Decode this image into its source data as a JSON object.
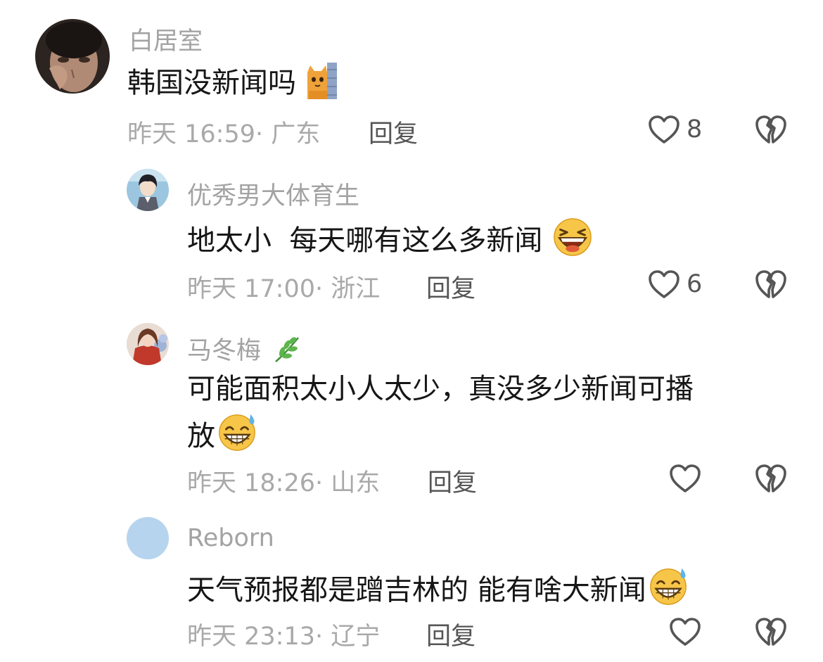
{
  "comments": [
    {
      "username": "白居室",
      "text": "韩国没新闻吗",
      "time": "昨天 16:59",
      "location": "广东",
      "reply_label": "回复",
      "likes": "8",
      "avatar_icon": "person-photo-avatar",
      "emoji_icon": "cat-peeking-emoji"
    },
    {
      "username": "优秀男大体育生",
      "text": "地太小  每天哪有这么多新闻",
      "time": "昨天 17:00",
      "location": "浙江",
      "reply_label": "回复",
      "likes": "6",
      "avatar_icon": "anime-boy-avatar",
      "emoji_icon": "laughing-emoji"
    },
    {
      "username": "马冬梅",
      "text_line1": "可能面积太小人太少，真没多少新闻可播",
      "text_line2": "放",
      "time": "昨天 18:26",
      "location": "山东",
      "reply_label": "回复",
      "likes": "",
      "avatar_icon": "woman-flowers-avatar",
      "emoji_icon": "grinning-sweat-emoji",
      "badge_icon": "leaf-icon"
    },
    {
      "username": "Reborn",
      "text": "天气预报都是蹭吉林的 能有啥大新闻",
      "time": "昨天 23:13",
      "location": "辽宁",
      "reply_label": "回复",
      "likes": "",
      "avatar_icon": "blank-blue-avatar",
      "emoji_icon": "grinning-sweat-emoji"
    }
  ],
  "meta_separator": "·",
  "colors": {
    "username": "#a3a3a3",
    "content": "#161616",
    "meta": "#a9a9a9",
    "reply": "#555555"
  }
}
